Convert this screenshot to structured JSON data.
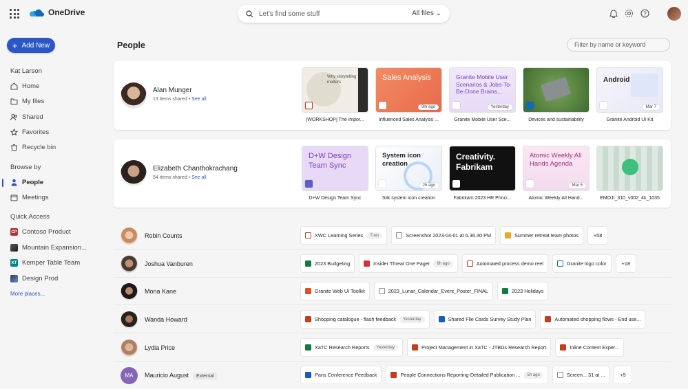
{
  "app": {
    "name": "OneDrive"
  },
  "search": {
    "placeholder": "Let's find some stuff",
    "filter": "All files"
  },
  "sidebar": {
    "add_new": "Add New",
    "user": "Kat Larson",
    "nav": [
      "Home",
      "My files",
      "Shared",
      "Favorites",
      "Recycle bin"
    ],
    "browse_by": "Browse by",
    "browse": [
      "People",
      "Meetings"
    ],
    "quick_access": "Quick Access",
    "qa": [
      {
        "label": "Contoso Product",
        "abbr": "CP",
        "color": "#a4373a"
      },
      {
        "label": "Mountain Expansion...",
        "abbr": "",
        "color": "#444444"
      },
      {
        "label": "Kemper Table Team",
        "abbr": "KT",
        "color": "#038387"
      },
      {
        "label": "Design Prod",
        "abbr": "",
        "color": "#2b3a67"
      }
    ],
    "more": "More places..."
  },
  "main": {
    "title": "People",
    "filter_placeholder": "Filter by name or keyword",
    "featured": [
      {
        "name": "Alan Munger",
        "items": "13 items shared",
        "see_all": "See all",
        "files": [
          {
            "caption": "[WORKSHOP] The impor...",
            "big": "Why storytelling matters",
            "meta": ""
          },
          {
            "caption": "Influenced Sales Analysis ...",
            "big": "Sales Analysis",
            "meta": "9m ago"
          },
          {
            "caption": "Granite Mobile User Sce...",
            "big": "Granite Mobile User Scenarios & Jobs-To-Be-Done Brains...",
            "meta": "Yesterday"
          },
          {
            "caption": "Devices and sustainability",
            "big": "",
            "meta": ""
          },
          {
            "caption": "Granite Android UI Kit",
            "big": "Android UI Kit",
            "meta": "Mar 7"
          }
        ]
      },
      {
        "name": "Elizabeth Chanthokrachang",
        "items": "54 items shared",
        "see_all": "See all",
        "files": [
          {
            "caption": "D+W Design Team Sync",
            "big": "D+W Design Team Sync",
            "meta": ""
          },
          {
            "caption": "Silk system icon creation",
            "big": "System icon creation",
            "meta": "2h ago"
          },
          {
            "caption": "Fabrikam 2023 HR Princi...",
            "big": "Creativity. Fabrikam",
            "meta": ""
          },
          {
            "caption": "Atomic Weekly All Hand...",
            "big": "Atomic Weekly All Hands Agenda",
            "meta": "Mar 5"
          },
          {
            "caption": "EMOJI_310_v002_4k_1035",
            "big": "",
            "meta": ""
          }
        ]
      }
    ],
    "rows": [
      {
        "name": "Robin Counts",
        "external": "",
        "files": [
          {
            "label": "XWC Learning Series",
            "meta": "Tues",
            "type": "wd"
          },
          {
            "label": "Screenshot 2023-04-01 at 6.36.30 PM",
            "meta": "",
            "type": "img"
          },
          {
            "label": "Summer retreat team photos",
            "meta": "",
            "type": "fd"
          }
        ],
        "more": "+58"
      },
      {
        "name": "Joshua Vanburen",
        "external": "",
        "files": [
          {
            "label": "2023 Budgeting",
            "meta": "",
            "type": "xl"
          },
          {
            "label": "Insider Threat One Pager",
            "meta": "6h ago",
            "type": "pdf"
          },
          {
            "label": "Automated process demo reel",
            "meta": "",
            "type": "vid"
          },
          {
            "label": "Granite logo color",
            "meta": "",
            "type": "img"
          }
        ],
        "more": "+18"
      },
      {
        "name": "Mona Kane",
        "external": "",
        "files": [
          {
            "label": "Granite Web UI Toolkit",
            "meta": "",
            "type": "fg"
          },
          {
            "label": "2023_Lunar_Calendar_Event_Poster_FINAL",
            "meta": "",
            "type": "img"
          },
          {
            "label": "2023 Holidays",
            "meta": "",
            "type": "xl"
          }
        ],
        "more": ""
      },
      {
        "name": "Wanda Howard",
        "external": "",
        "files": [
          {
            "label": "Shopping catalogue - flash feedback",
            "meta": "Yesterday",
            "type": "p"
          },
          {
            "label": "Shared File Cards Survey Study Plan",
            "meta": "",
            "type": "wd"
          },
          {
            "label": "Automated shopping flows - End use...",
            "meta": "",
            "type": "p"
          }
        ],
        "more": ""
      },
      {
        "name": "Lydia Price",
        "external": "",
        "files": [
          {
            "label": "XaTC Research Reports",
            "meta": "Yesterday",
            "type": "xl"
          },
          {
            "label": "Project Management in XaTC - JTBDs Research Report",
            "meta": "",
            "type": "p"
          },
          {
            "label": "Inline Content Exper...",
            "meta": "",
            "type": "p"
          }
        ],
        "more": ""
      },
      {
        "name": "Mauricio August",
        "external": "External",
        "files": [
          {
            "label": "Paris Conference Feedback",
            "meta": "",
            "type": "wd"
          },
          {
            "label": "People Connections Reporting-Detailed Publication ...",
            "meta": "5h ago",
            "type": "p"
          },
          {
            "label": "Screen... 31 at ...",
            "meta": "",
            "type": "img"
          }
        ],
        "more": "+5"
      }
    ]
  }
}
